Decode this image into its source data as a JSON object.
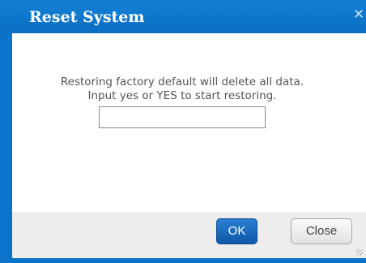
{
  "dialog": {
    "title": "Reset System",
    "close_icon": "close-icon",
    "message_line1": "Restoring factory default will delete all data.",
    "message_line2": "Input yes or YES to start restoring.",
    "input_value": "",
    "ok_label": "OK",
    "close_label": "Close"
  },
  "colors": {
    "titlebar": "#0b74c9",
    "ok_button": "#1565b8",
    "footer": "#ededed"
  }
}
